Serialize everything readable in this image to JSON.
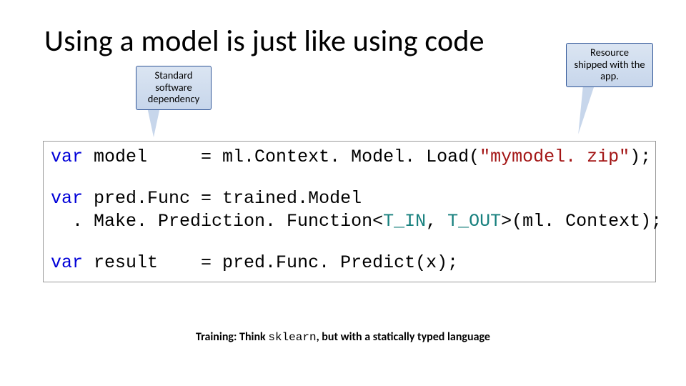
{
  "title": "Using a model is just like using code",
  "callouts": {
    "left": "Standard software dependency",
    "right": "Resource shipped with the app."
  },
  "code": {
    "kw_var": "var",
    "l1_a": " model     = ml.Context. Model. Load(",
    "l1_str": "\"mymodel. zip\"",
    "l1_b": ");",
    "l2_a": " pred.Func = trained.Model",
    "l3_a": "  . Make. Prediction. Function<",
    "l3_t1": "T_IN",
    "l3_mid": ", ",
    "l3_t2": "T_OUT",
    "l3_b": ">(ml. Context);",
    "l4_a": " result    = pred.Func. Predict(x);"
  },
  "footer": {
    "a": "Training: Think ",
    "mono": "sklearn",
    "b": ", but with a statically typed language"
  }
}
